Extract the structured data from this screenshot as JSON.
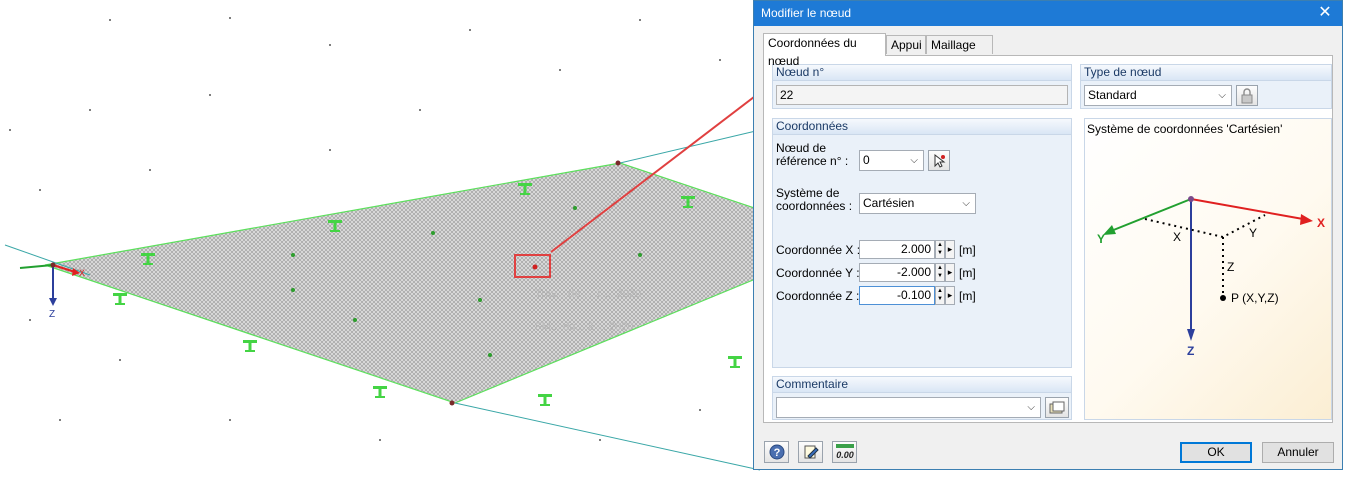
{
  "model": {
    "axis_label_z": "Z",
    "axis_label_x": "X",
    "watermark_1": "Trav... de ... 1 ... 2020",
    "watermark_2": "FM... du... 2 ... 2020"
  },
  "dialog": {
    "title": "Modifier le nœud",
    "close_glyph": "✕",
    "tabs": [
      "Coordonnées du nœud",
      "Appui",
      "Maillage EF"
    ],
    "node_group": {
      "header": "Nœud n°",
      "value": "22"
    },
    "type_group": {
      "header": "Type de nœud",
      "value": "Standard"
    },
    "coords_group": {
      "header": "Coordonnées",
      "ref_label_1": "Nœud de",
      "ref_label_2": "référence n° :",
      "ref_value": "0",
      "sys_label_1": "Système de",
      "sys_label_2": "coordonnées :",
      "sys_value": "Cartésien",
      "x_label": "Coordonnée X :",
      "x_value": "2.000",
      "y_label": "Coordonnée Y :",
      "y_value": "-2.000",
      "z_label": "Coordonnée Z :",
      "z_value": "-0.100",
      "unit": "[m]"
    },
    "system_box": {
      "title": "Système de coordonnées 'Cartésien'",
      "axis_x": "X",
      "axis_y": "Y",
      "axis_z": "Z",
      "dim_x": "X",
      "dim_y": "Y",
      "dim_z": "Z",
      "point": "P (X,Y,Z)"
    },
    "comment_group": {
      "header": "Commentaire",
      "value": ""
    },
    "footer": {
      "ok": "OK",
      "cancel": "Annuler",
      "units_icon_text": "0.00"
    }
  },
  "colors": {
    "title_bar": "#1e7ad6",
    "annotation": "#e04040",
    "support_green": "#44d444",
    "axis_blue": "#2c3f9c",
    "axis_red": "#e02020",
    "axis_green": "#22a030"
  }
}
